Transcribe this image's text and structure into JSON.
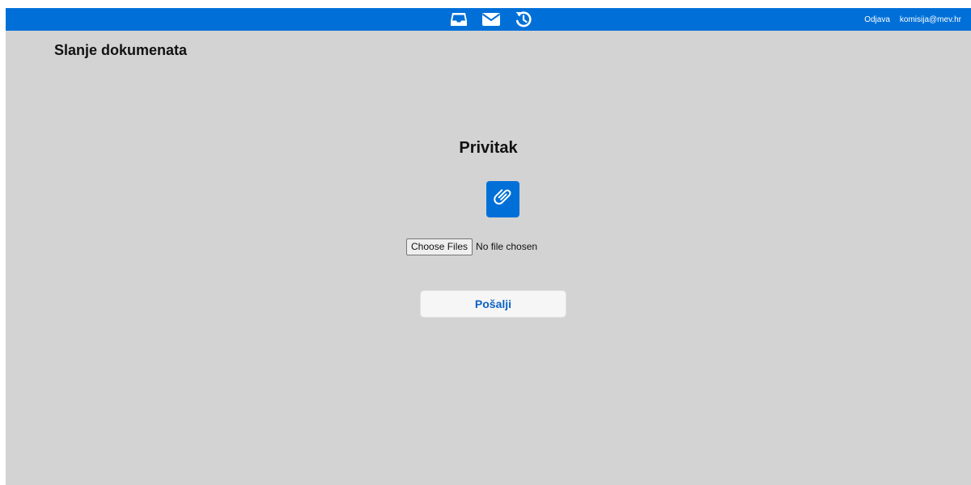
{
  "header": {
    "nav_icons": [
      "inbox-icon",
      "envelope-icon",
      "history-icon"
    ],
    "logout_label": "Odjava",
    "user_email": "komisija@mev.hr",
    "accent_color": "#0070d8"
  },
  "main": {
    "page_title": "Slanje dokumenata",
    "section_title": "Privitak",
    "attach_icon": "paperclip-icon",
    "file_input": {
      "button_label": "Choose Files",
      "status": "No file chosen"
    },
    "send_label": "Pošalji"
  },
  "colors": {
    "background": "#d3d3d3",
    "send_text": "#0b63c4"
  }
}
